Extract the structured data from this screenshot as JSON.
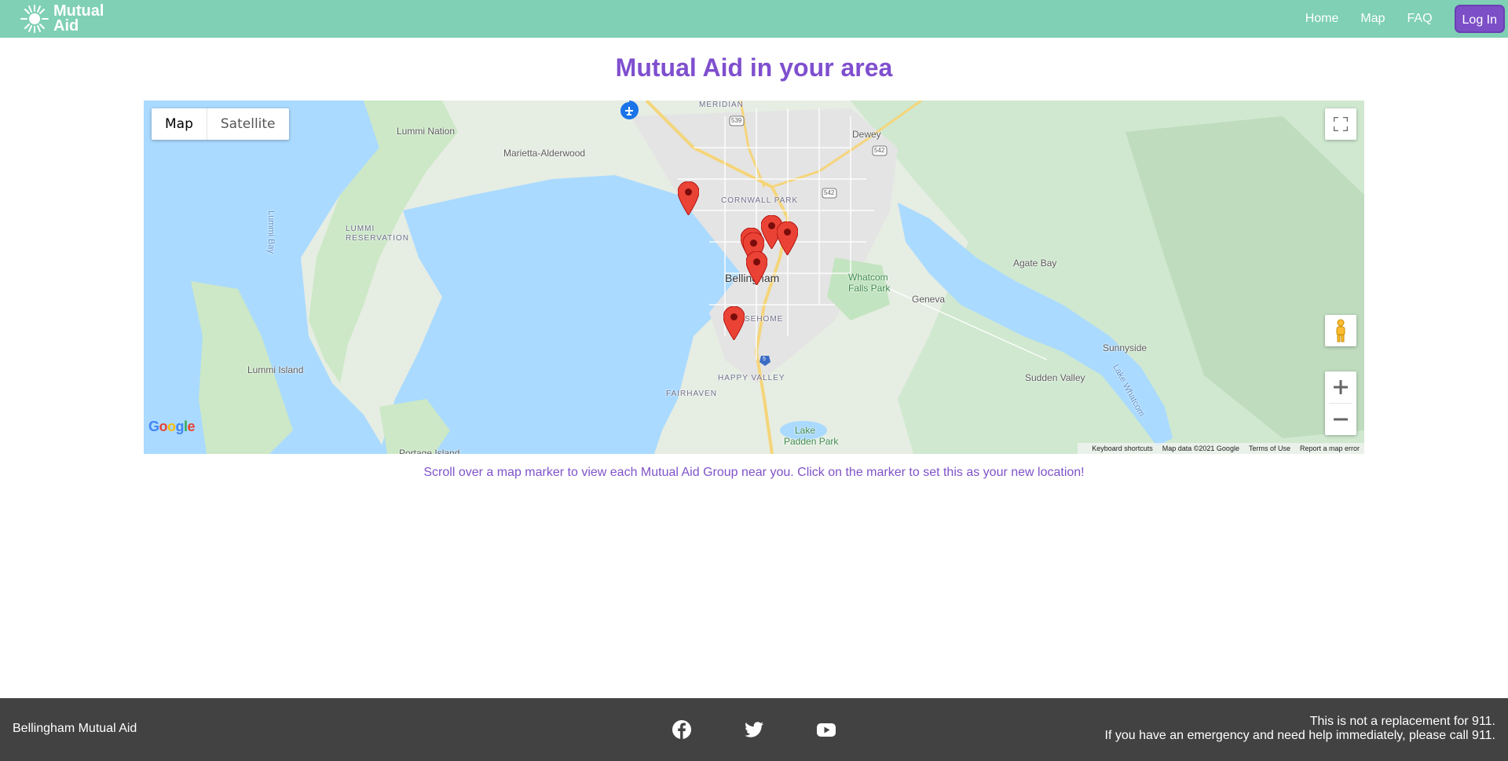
{
  "nav": {
    "brand_line1": "Mutual",
    "brand_line2": "Aid",
    "brand_icon": "sun-flower-logo-icon",
    "links": [
      "Home",
      "Map",
      "FAQ"
    ],
    "login_label": "Log In",
    "bg_color": "#7fd0b5",
    "accent_color": "#7c4fc7"
  },
  "main": {
    "title": "Mutual Aid in your area",
    "caption": "Scroll over a map marker to view each Mutual Aid Group near you. Click on the marker to set this as your new location!"
  },
  "map": {
    "type_options": [
      "Map",
      "Satellite"
    ],
    "selected_type": "Map",
    "attribution": {
      "shortcuts": "Keyboard shortcuts",
      "data": "Map data ©2021 Google",
      "terms": "Terms of Use",
      "report": "Report a map error"
    },
    "labels": {
      "lummi_nation": "Lummi Nation",
      "marietta": "Marietta-Alderwood",
      "meridian": "MERIDIAN",
      "dewey": "Dewey",
      "cornwall": "CORNWALL PARK",
      "lummi_bay": "Lummi Bay",
      "lummi_res_1": "LUMMI",
      "lummi_res_2": "RESERVATION",
      "bellingham": "Bellingham",
      "whatcom_1": "Whatcom",
      "whatcom_2": "Falls Park",
      "geneva": "Geneva",
      "agate_bay": "Agate Bay",
      "sehome": "SEHOME",
      "sunnyside": "Sunnyside",
      "lummi_island": "Lummi Island",
      "sudden_valley": "Sudden Valley",
      "lake_whatcom": "Lake Whatcom",
      "happy_valley": "HAPPY VALLEY",
      "fairhaven": "FAIRHAVEN",
      "lake_padden_1": "Lake",
      "lake_padden_2": "Padden Park",
      "portage": "Portage Island",
      "sr539": "539",
      "sr542a": "542",
      "sr542b": "542",
      "i5": "5"
    },
    "marker_count": 7,
    "google_logo": "Google"
  },
  "footer": {
    "org_name": "Bellingham Mutual Aid",
    "social_icons": [
      "facebook-icon",
      "twitter-icon",
      "youtube-icon"
    ],
    "notice_line1": "This is not a replacement for 911.",
    "notice_line2": "If you have an emergency and need help immediately, please call 911."
  }
}
